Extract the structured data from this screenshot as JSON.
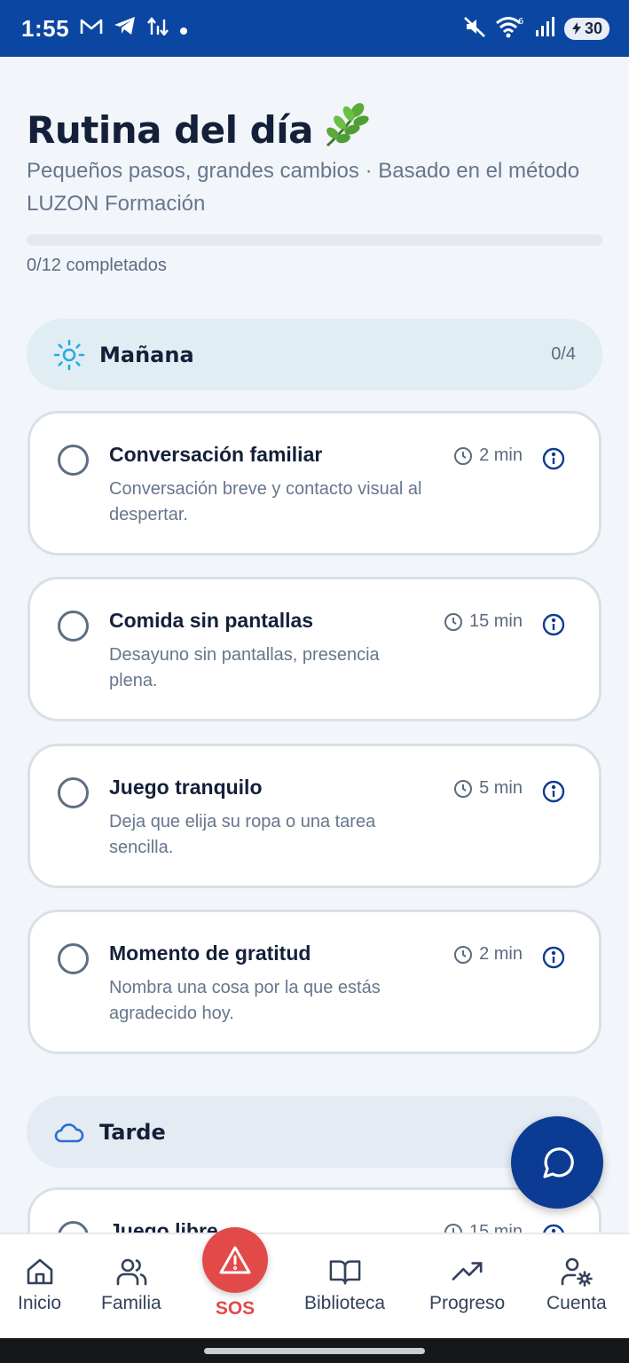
{
  "status_bar": {
    "time": "1:55",
    "battery": "30",
    "left_icons": [
      "gmail-icon",
      "telegram-icon",
      "data-transfer-icon",
      "dot-icon"
    ],
    "right_icons": [
      "mute-icon",
      "wifi-6-icon",
      "signal-icon",
      "battery-icon"
    ]
  },
  "header": {
    "title": "Rutina del día",
    "title_emoji": "🌿",
    "subtitle": "Pequeños pasos, grandes cambios · Basado en el método LUZON Formación"
  },
  "progress": {
    "text": "0/12 completados",
    "completed": 0,
    "total": 12,
    "fill_fraction": 0
  },
  "sections": {
    "morning": {
      "title": "Mañana",
      "count": "0/4",
      "icon": "sun-icon",
      "icon_color": "#29a9e0"
    },
    "afternoon": {
      "title": "Tarde",
      "icon": "cloud-icon",
      "icon_color": "#2a6fd1"
    }
  },
  "tasks": [
    {
      "title": "Conversación familiar",
      "desc": "Conversación breve y contacto visual al despertar.",
      "time": "2 min"
    },
    {
      "title": "Comida sin pantallas",
      "desc": "Desayuno sin pantallas, presencia plena.",
      "time": "15 min"
    },
    {
      "title": "Juego tranquilo",
      "desc": "Deja que elija su ropa o una tarea sencilla.",
      "time": "5 min"
    },
    {
      "title": "Momento de gratitud",
      "desc": "Nombra una cosa por la que estás agradecido hoy.",
      "time": "2 min"
    },
    {
      "title": "Juego libre",
      "desc": "",
      "time": "15 min"
    }
  ],
  "fab": {
    "icon": "chat-bubble-icon"
  },
  "bottom_nav": {
    "items": [
      {
        "label": "Inicio",
        "icon": "home-icon"
      },
      {
        "label": "Familia",
        "icon": "users-icon"
      },
      {
        "label": "SOS",
        "icon": "warning-icon",
        "color": "#e24a4a"
      },
      {
        "label": "Biblioteca",
        "icon": "book-icon"
      },
      {
        "label": "Progreso",
        "icon": "trending-up-icon"
      },
      {
        "label": "Cuenta",
        "icon": "user-settings-icon"
      }
    ]
  },
  "colors": {
    "primary": "#0c46a3",
    "background": "#f2f6fa",
    "sos": "#e24a4a",
    "morning_header": "#e0eef4",
    "afternoon_header": "#e5ebf3"
  }
}
